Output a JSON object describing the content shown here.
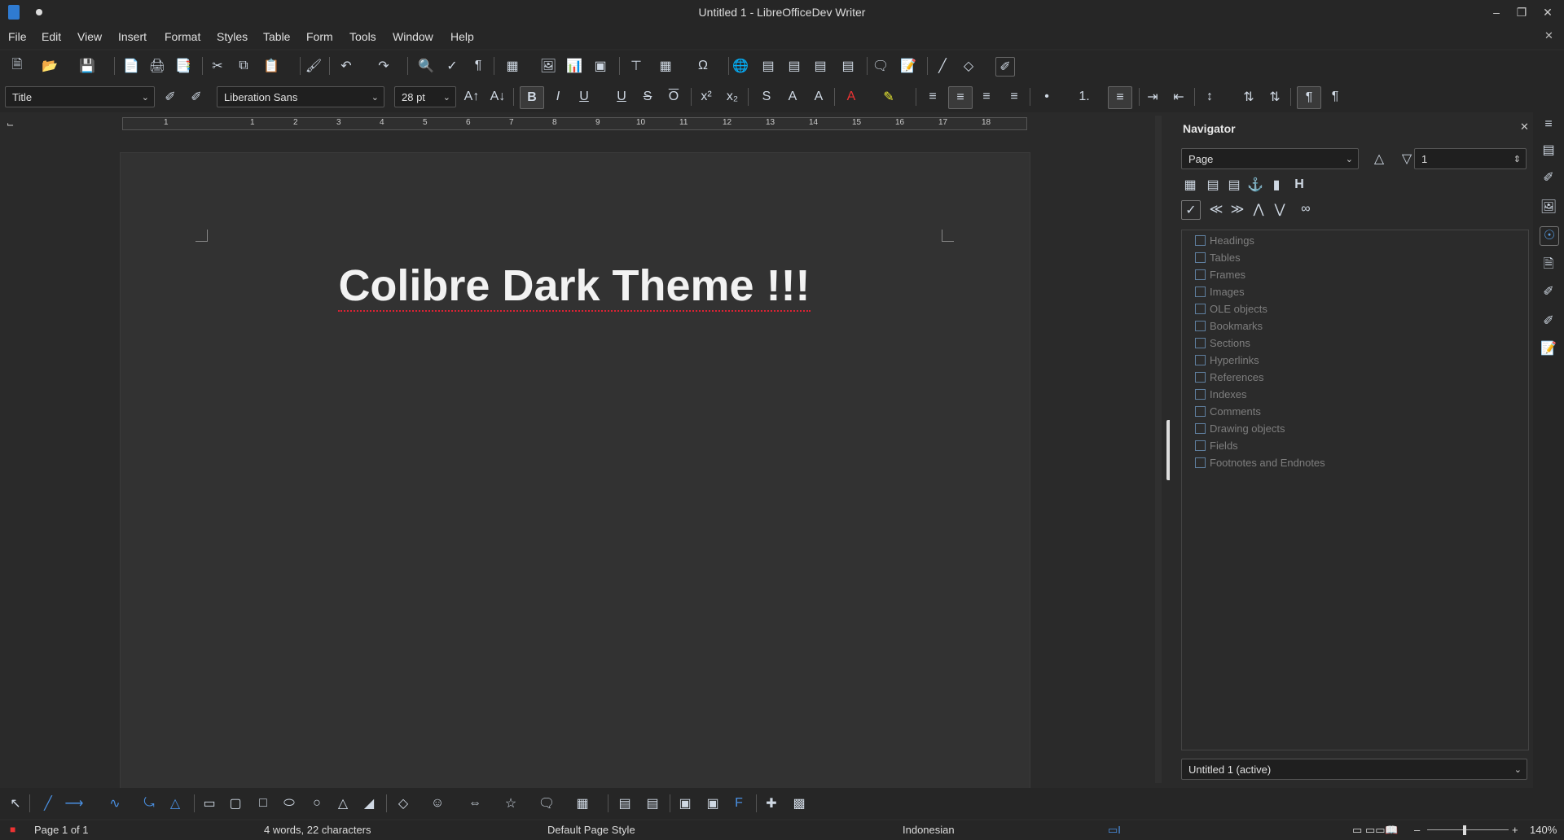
{
  "window": {
    "title": "Untitled 1 - LibreOfficeDev Writer"
  },
  "menu": [
    "File",
    "Edit",
    "View",
    "Insert",
    "Format",
    "Styles",
    "Table",
    "Form",
    "Tools",
    "Window",
    "Help"
  ],
  "formatting": {
    "paragraph_style": "Title",
    "font_name": "Liberation Sans",
    "font_size": "28 pt"
  },
  "ruler": {
    "ticks": [
      "1",
      "1",
      "2",
      "3",
      "4",
      "5",
      "6",
      "7",
      "8",
      "9",
      "10",
      "11",
      "12",
      "13",
      "14",
      "15",
      "16",
      "17",
      "18"
    ]
  },
  "document": {
    "heading": "Colibre Dark Theme !!!"
  },
  "navigator": {
    "title": "Navigator",
    "navigate_by": "Page",
    "page_number": "1",
    "categories": [
      "Headings",
      "Tables",
      "Frames",
      "Images",
      "OLE objects",
      "Bookmarks",
      "Sections",
      "Hyperlinks",
      "References",
      "Indexes",
      "Comments",
      "Drawing objects",
      "Fields",
      "Footnotes and Endnotes"
    ],
    "active_document": "Untitled 1 (active)"
  },
  "statusbar": {
    "page": "Page 1 of 1",
    "words": "4 words, 22 characters",
    "page_style": "Default Page Style",
    "language": "Indonesian",
    "zoom": "140%"
  },
  "colors": {
    "accent": "#2f7bd1",
    "background": "#2a2a2a",
    "toolbar": "#262626"
  }
}
